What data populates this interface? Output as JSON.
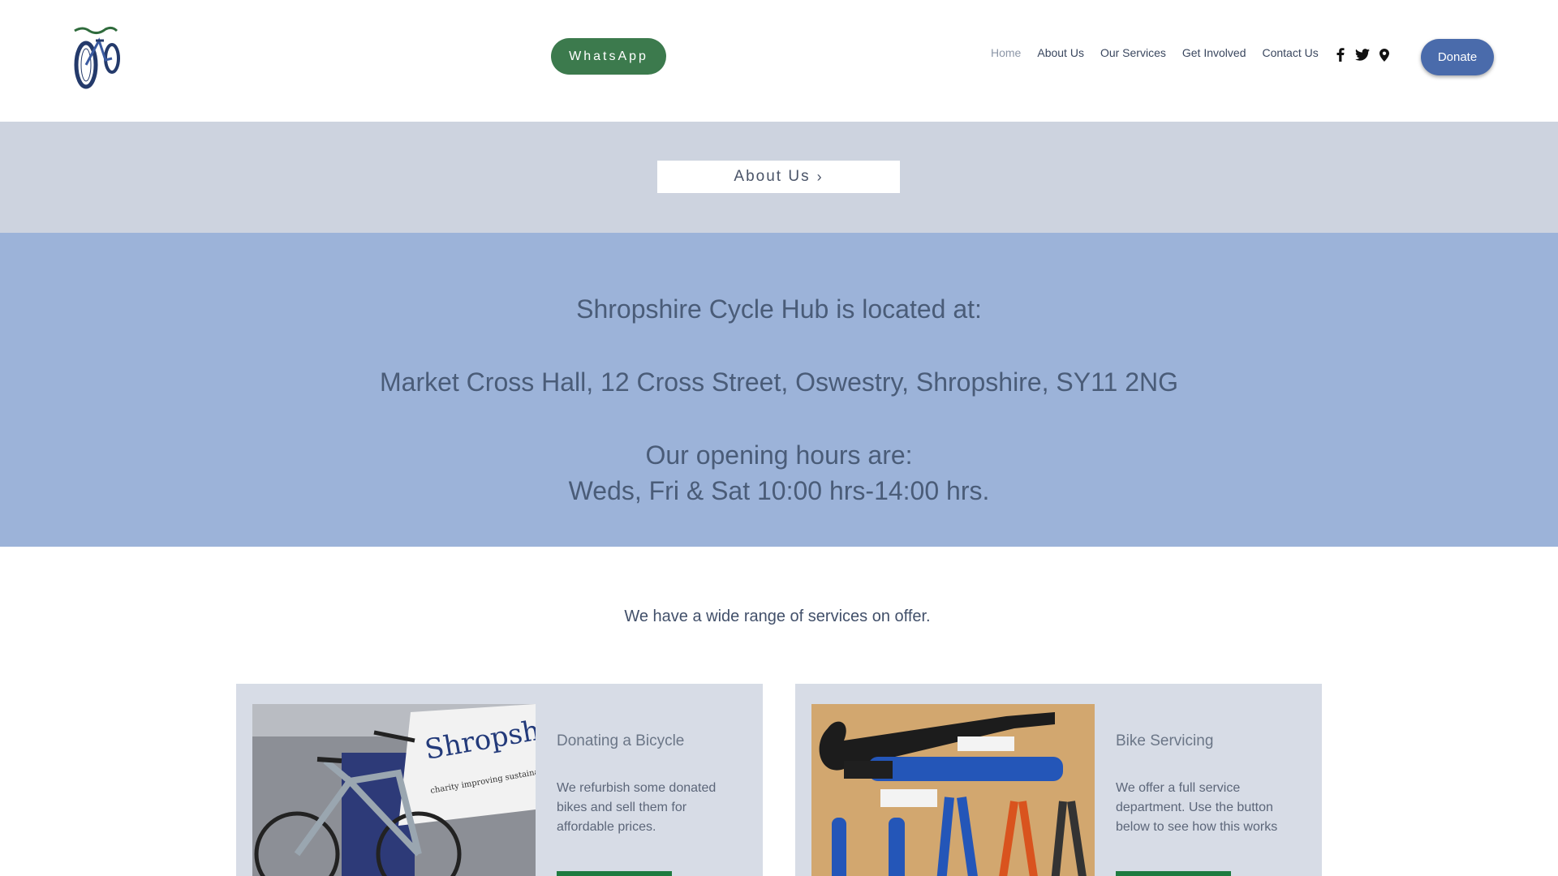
{
  "header": {
    "logo_icon": "bicycle-logo-icon",
    "whatsapp_label": "WhatsApp",
    "nav": [
      {
        "label": "Home",
        "active": true
      },
      {
        "label": "About Us",
        "active": false
      },
      {
        "label": "Our Services",
        "active": false
      },
      {
        "label": "Get Involved",
        "active": false
      },
      {
        "label": "Contact Us",
        "active": false
      }
    ],
    "social_icons": [
      "facebook-icon",
      "twitter-icon",
      "map-pin-icon"
    ],
    "donate_label": "Donate"
  },
  "about_band": {
    "button_label": "About Us",
    "chevron": "›"
  },
  "location": {
    "line1": "Shropshire Cycle Hub is located at:",
    "line2": "Market Cross Hall, 12 Cross Street, Oswestry, Shropshire, SY11 2NG",
    "line3": "Our opening hours are:",
    "line4": "Weds, Fri & Sat 10:00 hrs-14:00 hrs."
  },
  "services": {
    "intro": "We have a wide range of services on offer.",
    "cards": [
      {
        "title": "Donating a Bicycle",
        "description": "We refurbish some donated bikes and sell them for affordable prices.",
        "image_banner_text": "Shropshire Cycle Hub",
        "image_banner_subtext": "charity improving sustainable transport"
      },
      {
        "title": "Bike Servicing",
        "description": "We offer a full service department. Use the button below to see how this works"
      }
    ]
  },
  "colors": {
    "whatsapp_green": "#3c7a4d",
    "donate_blue": "#4a6bab",
    "about_band": "#cdd3df",
    "location_band": "#9cb3d9",
    "card_bg": "#d7dce6",
    "card_button_green": "#1e7b40"
  }
}
